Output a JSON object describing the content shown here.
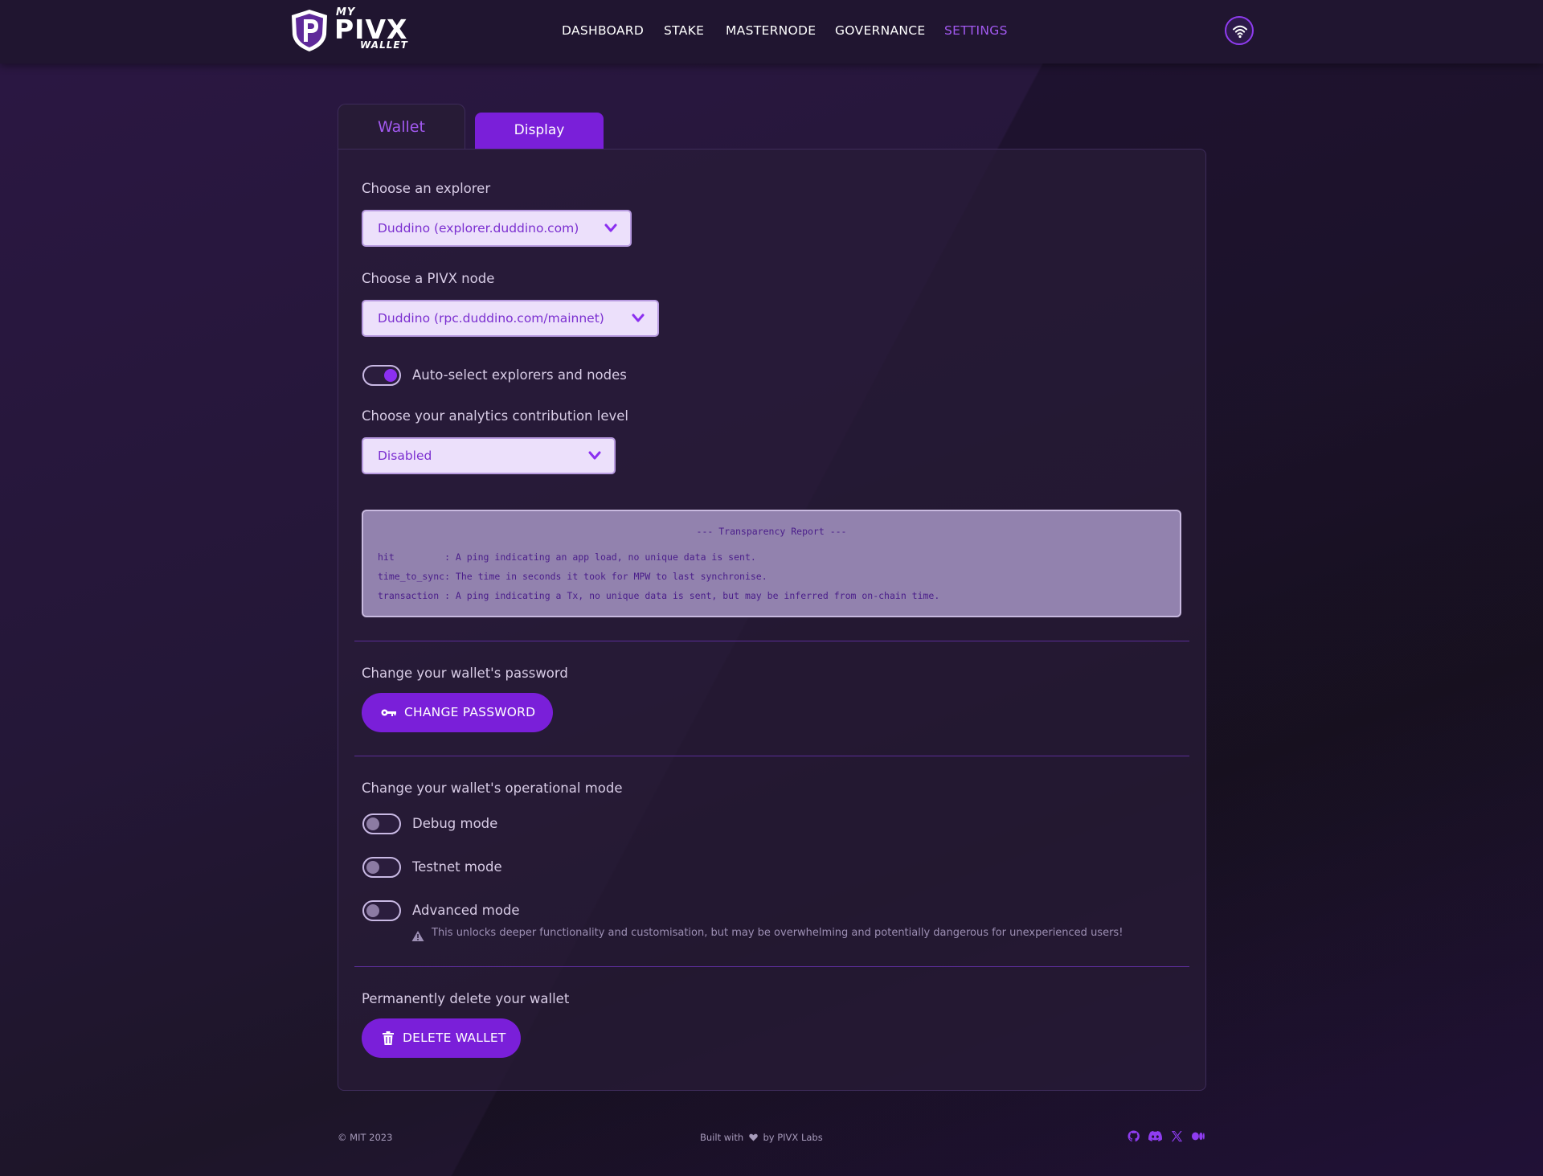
{
  "header": {
    "logo": {
      "my": "MY",
      "pivx": "PIVX",
      "wallet": "WALLET"
    },
    "nav": [
      "DASHBOARD",
      "STAKE",
      "MASTERNODE",
      "GOVERNANCE",
      "SETTINGS"
    ],
    "active_nav": "SETTINGS",
    "network_icon": "wifi-icon"
  },
  "tabs": {
    "wallet": "Wallet",
    "display": "Display",
    "active": "Wallet"
  },
  "settings": {
    "explorer_label": "Choose an explorer",
    "explorer_value": "Duddino (explorer.duddino.com)",
    "node_label": "Choose a PIVX node",
    "node_value": "Duddino (rpc.duddino.com/mainnet)",
    "auto_select_label": "Auto-select explorers and nodes",
    "auto_select_on": true,
    "analytics_label": "Choose your analytics contribution level",
    "analytics_value": "Disabled",
    "report": {
      "title": "--- Transparency Report ---",
      "lines": [
        "hit         : A ping indicating an app load, no unique data is sent.",
        "time_to_sync: The time in seconds it took for MPW to last synchronise.",
        "transaction : A ping indicating a Tx, no unique data is sent, but may be inferred from on-chain time."
      ]
    },
    "password_label": "Change your wallet's password",
    "password_button": "CHANGE PASSWORD",
    "mode_label": "Change your wallet's operational mode",
    "debug_label": "Debug mode",
    "testnet_label": "Testnet mode",
    "advanced_label": "Advanced mode",
    "advanced_warning": "This unlocks deeper functionality and customisation, but may be overwhelming and potentially dangerous for unexperienced users!",
    "delete_label": "Permanently delete your wallet",
    "delete_button": "DELETE WALLET"
  },
  "footer": {
    "copyright": "© MIT 2023",
    "built_with": "Built with",
    "by": "by PIVX Labs",
    "social_icons": [
      "github-icon",
      "discord-icon",
      "x-icon",
      "medium-icon"
    ]
  },
  "colors": {
    "accent": "#7a1fd9",
    "accent_light": "#a259f0",
    "background": "#241737"
  }
}
